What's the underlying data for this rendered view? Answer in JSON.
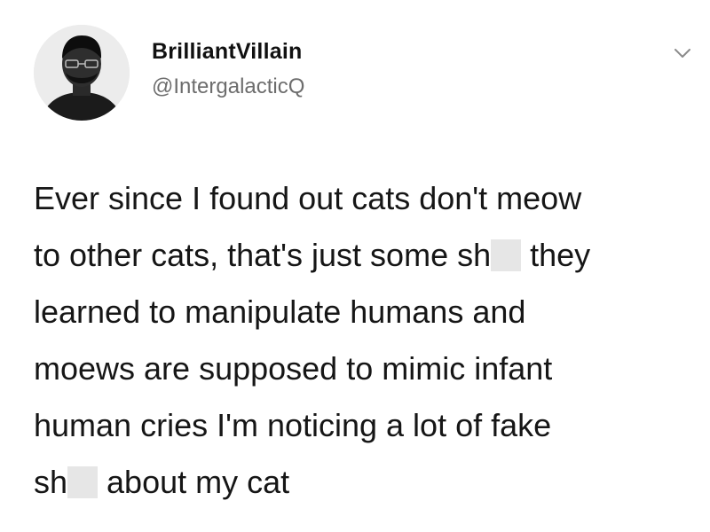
{
  "author": {
    "display_name": "BrilliantVillain",
    "handle": "@IntergalacticQ"
  },
  "icons": {
    "menu": "chevron-down-icon",
    "avatar": "profile-photo"
  },
  "tweet": {
    "lines": [
      {
        "before": "Ever since I found out cats don't meow"
      },
      {
        "before": "to other cats, that's just some sh",
        "after": " they"
      },
      {
        "before": "learned to manipulate humans and"
      },
      {
        "before": "moews are supposed to mimic infant"
      },
      {
        "before": "human cries I'm noticing a lot of fake"
      },
      {
        "before": "sh",
        "after": " about my cat"
      }
    ]
  },
  "colors": {
    "text": "#161616",
    "handle": "#6d6d6d",
    "redaction": "#e6e6e6"
  }
}
